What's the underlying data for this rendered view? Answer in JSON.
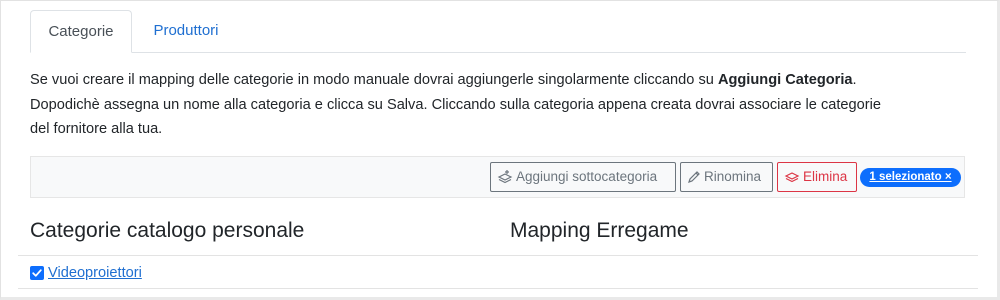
{
  "tabs": [
    {
      "label": "Categorie",
      "active": true
    },
    {
      "label": "Produttori",
      "active": false
    }
  ],
  "description": {
    "line1_pre": "Se vuoi creare il mapping delle categorie in modo manuale dovrai aggiungerle singolarmente cliccando su ",
    "line1_bold": "Aggiungi Categoria",
    "line1_post": ".",
    "line2": "Dopodichè assegna un nome alla categoria e clicca su Salva. Cliccando sulla categoria appena creata dovrai associare le categorie",
    "line3": "del fornitore alla tua."
  },
  "toolbar": {
    "add_sub_label": "Aggiungi sottocategoria",
    "rename_label": "Rinomina",
    "delete_label": "Elimina",
    "selected_badge": "1 selezionato ×"
  },
  "headings": {
    "personal_catalog": "Categorie catalogo personale",
    "mapping": "Mapping Erregame"
  },
  "tree": {
    "items": [
      {
        "label": "Videoproiettori",
        "checked": true
      }
    ]
  },
  "colors": {
    "primary": "#0d6efd",
    "link": "#1f6fd1",
    "danger": "#dc3545",
    "secondary": "#6c757d",
    "toolbar_bg": "#f8f9fa"
  },
  "icons": {
    "add_sub": "layers-plus-icon",
    "rename": "pencil-icon",
    "delete": "layers-remove-icon",
    "checkbox": "checkbox-checked-icon"
  }
}
